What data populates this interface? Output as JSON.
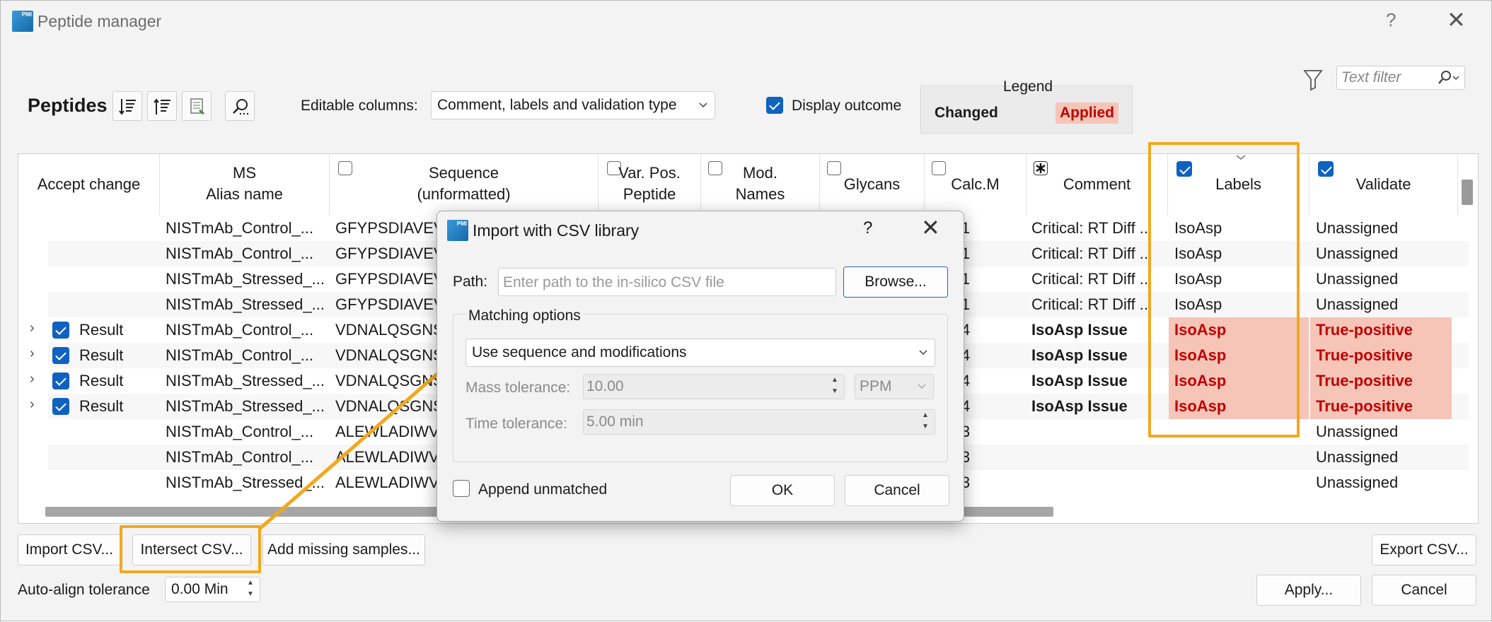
{
  "window": {
    "title": "Peptide manager",
    "help": "?",
    "close": "✕",
    "icon_text": "PMI"
  },
  "toolbar": {
    "title": "Peptides",
    "editable_label": "Editable columns:",
    "editable_value": "Comment, labels and validation type",
    "display_outcome_label": "Display outcome",
    "display_outcome_checked": true
  },
  "legend": {
    "title": "Legend",
    "changed": "Changed",
    "applied": "Applied"
  },
  "filter": {
    "placeholder": "Text filter"
  },
  "columns": {
    "accept": "Accept change",
    "ms_line1": "MS",
    "ms_line2": "Alias name",
    "seq_line1": "Sequence",
    "seq_line2": "(unformatted)",
    "var_line1": "Var. Pos.",
    "var_line2": "Peptide",
    "mod_line1": "Mod.",
    "mod_line2": "Names",
    "glycans": "Glycans",
    "calc": "Calc.M",
    "comment": "Comment",
    "labels": "Labels",
    "validate": "Validate"
  },
  "rows": [
    {
      "accept": "",
      "alias": "NISTmAb_Control_...",
      "seq": "GFYPSDIAVEV",
      "calc": ".1081",
      "comment": "Critical: RT Diff ...",
      "label": "IsoAsp",
      "validate": "Unassigned",
      "applied": false
    },
    {
      "accept": "",
      "alias": "NISTmAb_Control_...",
      "seq": "GFYPSDIAVEV",
      "calc": ".1081",
      "comment": "Critical: RT Diff ...",
      "label": "IsoAsp",
      "validate": "Unassigned",
      "applied": false
    },
    {
      "accept": "",
      "alias": "NISTmAb_Stressed_...",
      "seq": "GFYPSDIAVEV",
      "calc": ".1081",
      "comment": "Critical: RT Diff ...",
      "label": "IsoAsp",
      "validate": "Unassigned",
      "applied": false
    },
    {
      "accept": "",
      "alias": "NISTmAb_Stressed_...",
      "seq": "GFYPSDIAVEV",
      "calc": ".1081",
      "comment": "Critical: RT Diff ...",
      "label": "IsoAsp",
      "validate": "Unassigned",
      "applied": false
    },
    {
      "accept": "Result",
      "alias": "NISTmAb_Control_...",
      "seq": "VDNALQSGNS",
      "calc": ".9614",
      "comment": "IsoAsp Issue",
      "label": "IsoAsp",
      "validate": "True-positive",
      "applied": true
    },
    {
      "accept": "Result",
      "alias": "NISTmAb_Control_...",
      "seq": "VDNALQSGNS",
      "calc": ".9614",
      "comment": "IsoAsp Issue",
      "label": "IsoAsp",
      "validate": "True-positive",
      "applied": true
    },
    {
      "accept": "Result",
      "alias": "NISTmAb_Stressed_...",
      "seq": "VDNALQSGNS",
      "calc": ".9614",
      "comment": "IsoAsp Issue",
      "label": "IsoAsp",
      "validate": "True-positive",
      "applied": true
    },
    {
      "accept": "Result",
      "alias": "NISTmAb_Stressed_...",
      "seq": "VDNALQSGNS",
      "calc": ".9614",
      "comment": "IsoAsp Issue",
      "label": "IsoAsp",
      "validate": "True-positive",
      "applied": true
    },
    {
      "accept": "",
      "alias": "NISTmAb_Control_...",
      "seq": "ALEWLADIWV",
      "calc": ".7933",
      "comment": "",
      "label": "",
      "validate": "Unassigned",
      "applied": false
    },
    {
      "accept": "",
      "alias": "NISTmAb_Control_...",
      "seq": "ALEWLADIWV",
      "calc": ".7933",
      "comment": "",
      "label": "",
      "validate": "Unassigned",
      "applied": false
    },
    {
      "accept": "",
      "alias": "NISTmAb_Stressed_...",
      "seq": "ALEWLADIWV",
      "calc": ".7933",
      "comment": "",
      "label": "",
      "validate": "Unassigned",
      "applied": false
    }
  ],
  "bottom": {
    "import_csv": "Import CSV...",
    "intersect_csv": "Intersect CSV...",
    "add_missing": "Add missing samples...",
    "export_csv": "Export CSV...",
    "auto_align_label": "Auto-align tolerance",
    "auto_align_value": "0.00 Min",
    "apply": "Apply...",
    "cancel": "Cancel"
  },
  "dialog": {
    "title": "Import with CSV library",
    "help": "?",
    "close": "✕",
    "path_label": "Path:",
    "path_placeholder": "Enter path to the in-silico CSV file",
    "browse": "Browse...",
    "matching_title": "Matching options",
    "matching_value": "Use sequence and modifications",
    "mass_label": "Mass tolerance:",
    "mass_value": "10.00",
    "mass_unit": "PPM",
    "time_label": "Time tolerance:",
    "time_value": "5.00 min",
    "append_label": "Append unmatched",
    "ok": "OK",
    "cancel": "Cancel"
  },
  "colors": {
    "accent": "#0f62c0",
    "applied_bg": "#f6c5b8",
    "applied_text": "#c00000",
    "highlight": "#f2a81d"
  }
}
